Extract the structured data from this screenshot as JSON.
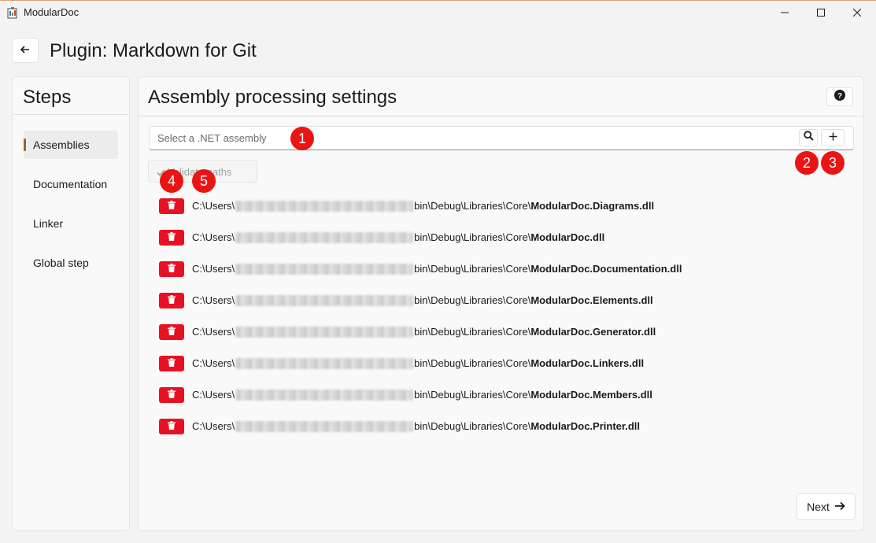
{
  "window": {
    "title": "ModularDoc"
  },
  "header": {
    "title": "Plugin: Markdown for Git"
  },
  "steps": {
    "title": "Steps",
    "items": [
      {
        "label": "Assemblies",
        "active": true
      },
      {
        "label": "Documentation",
        "active": false
      },
      {
        "label": "Linker",
        "active": false
      },
      {
        "label": "Global step",
        "active": false
      }
    ]
  },
  "main": {
    "title": "Assembly processing settings",
    "assembly_input": {
      "placeholder": "Select a .NET assembly",
      "value": ""
    },
    "validate_label": "Validate paths",
    "next_label": "Next",
    "assemblies": [
      {
        "prefix": "C:\\Users\\",
        "suffix": "bin\\Debug\\Libraries\\Core\\",
        "name": "ModularDoc.Diagrams.dll"
      },
      {
        "prefix": "C:\\Users\\",
        "suffix": "bin\\Debug\\Libraries\\Core\\",
        "name": "ModularDoc.dll"
      },
      {
        "prefix": "C:\\Users\\",
        "suffix": "bin\\Debug\\Libraries\\Core\\",
        "name": "ModularDoc.Documentation.dll"
      },
      {
        "prefix": "C:\\Users\\",
        "suffix": "bin\\Debug\\Libraries\\Core\\",
        "name": "ModularDoc.Elements.dll"
      },
      {
        "prefix": "C:\\Users\\",
        "suffix": "bin\\Debug\\Libraries\\Core\\",
        "name": "ModularDoc.Generator.dll"
      },
      {
        "prefix": "C:\\Users\\",
        "suffix": "bin\\Debug\\Libraries\\Core\\",
        "name": "ModularDoc.Linkers.dll"
      },
      {
        "prefix": "C:\\Users\\",
        "suffix": "bin\\Debug\\Libraries\\Core\\",
        "name": "ModularDoc.Members.dll"
      },
      {
        "prefix": "C:\\Users\\",
        "suffix": "bin\\Debug\\Libraries\\Core\\",
        "name": "ModularDoc.Printer.dll"
      }
    ]
  },
  "markers": [
    "1",
    "2",
    "3",
    "4",
    "5"
  ],
  "icons": {
    "back": "arrow-left-icon",
    "help": "question-icon",
    "search": "search-icon",
    "add": "plus-icon",
    "delete": "trash-icon",
    "next": "arrow-right-icon",
    "validate": "check-icon"
  },
  "colors": {
    "accent": "#a4621e",
    "delete": "#e81123",
    "marker": "#ea1414"
  }
}
